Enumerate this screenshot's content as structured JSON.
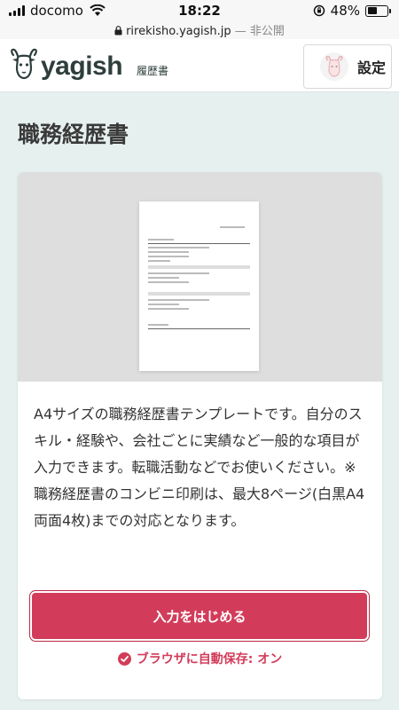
{
  "status_bar": {
    "carrier": "docomo",
    "time": "18:22",
    "battery": "48%",
    "battery_level": 0.48,
    "url": "rirekisho.yagish.jp",
    "url_note": "— 非公開"
  },
  "header": {
    "logo_text": "yagish",
    "logo_sub": "履歴書",
    "settings_label": "設定"
  },
  "page": {
    "title": "職務経歴書"
  },
  "card": {
    "description": "A4サイズの職務経歴書テンプレートです。自分のスキル・経験や、会社ごとに実績など一般的な項目が入力できます。転職活動などでお使いください。※職務経歴書のコンビニ印刷は、最大8ページ(白黒A4両面4枚)までの対応となります。",
    "start_button": "入力をはじめる",
    "autosave": "ブラウザに自動保存: オン"
  },
  "colors": {
    "accent": "#d23c5a",
    "background": "#e6f0ef",
    "logo": "#2e3e3c"
  },
  "icons": [
    "signal-icon",
    "wifi-icon",
    "rotation-lock-icon",
    "battery-icon",
    "lock-icon",
    "goat-logo-icon",
    "avatar-icon",
    "check-circle-icon"
  ]
}
